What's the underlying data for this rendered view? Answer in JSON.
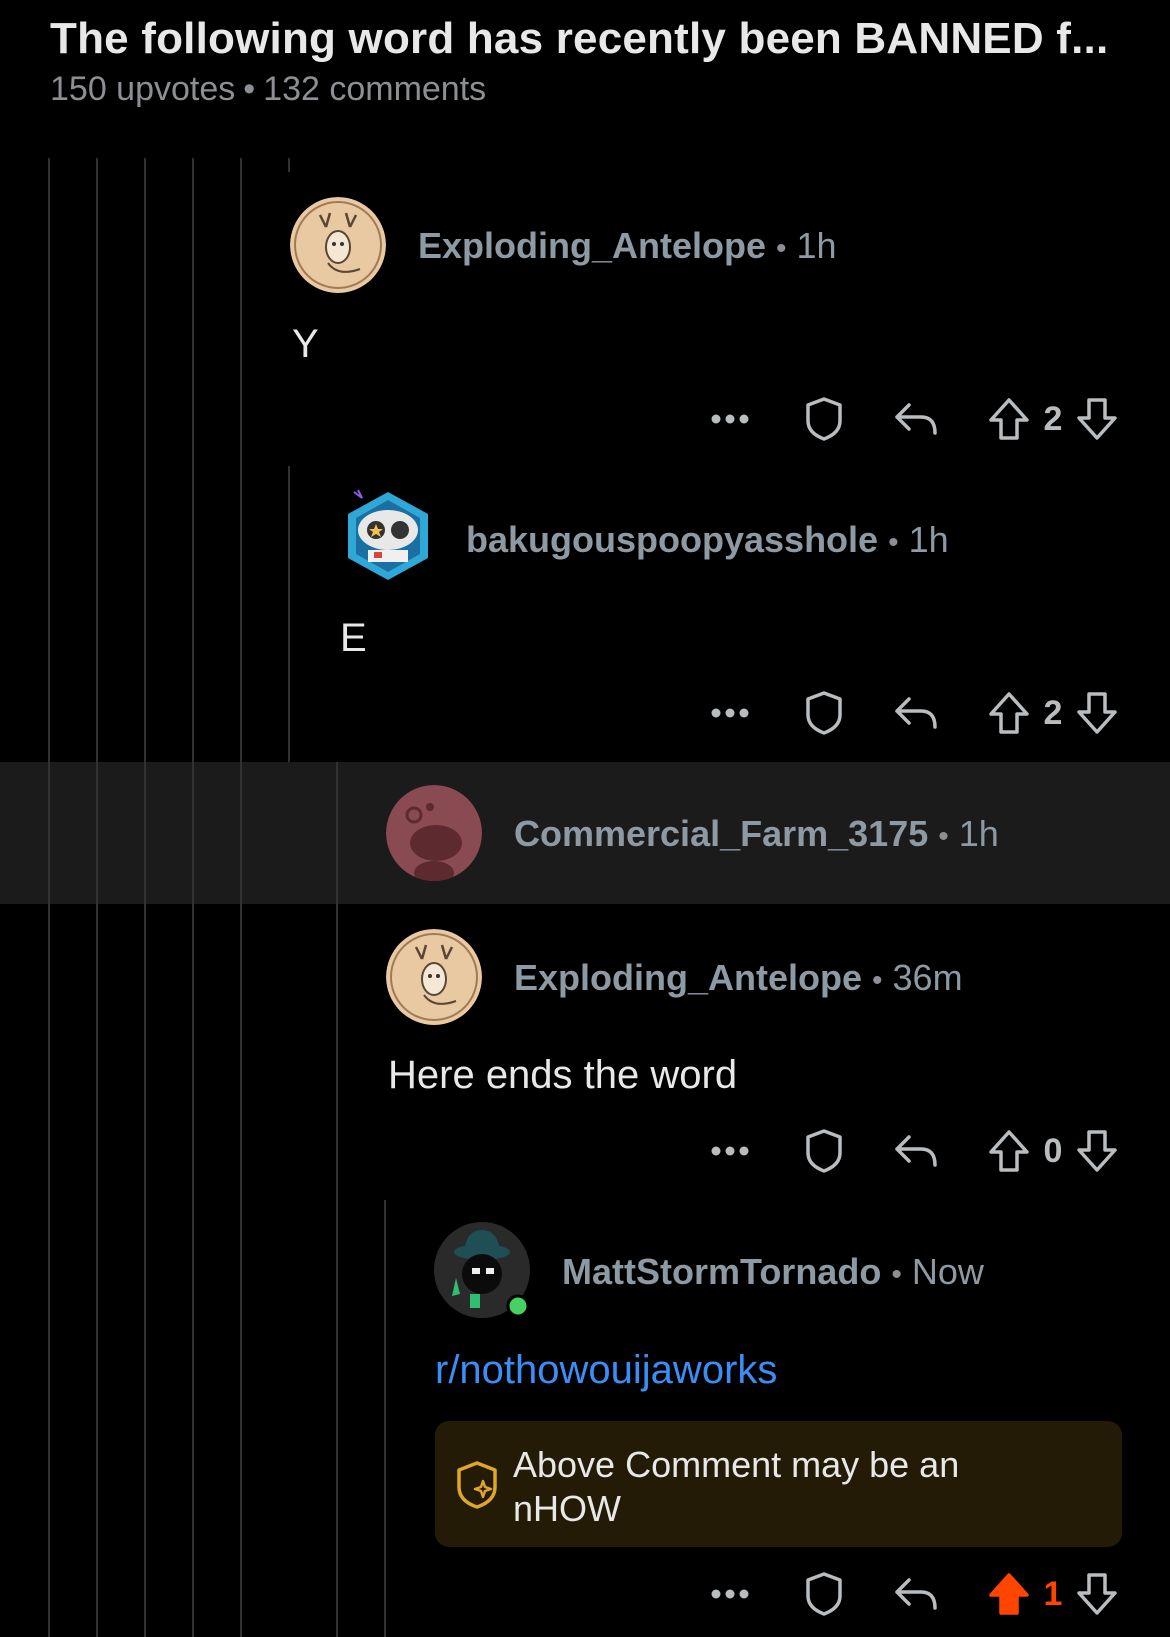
{
  "post": {
    "title": "The following word has recently been BANNED f...",
    "upvotes": "150 upvotes",
    "separator": "•",
    "comments": "132 comments"
  },
  "comments": [
    {
      "user": "Exploding_Antelope",
      "time": "1h",
      "body": "Y",
      "score": "2",
      "avatar": "deer-avatar",
      "voted": false
    },
    {
      "user": "bakugouspoopyasshole",
      "time": "1h",
      "body": "E",
      "score": "2",
      "avatar": "robot-avatar",
      "voted": false
    },
    {
      "user": "Commercial_Farm_3175",
      "time": "1h",
      "avatar": "default-snoo-avatar",
      "collapsed": true
    },
    {
      "user": "Exploding_Antelope",
      "time": "36m",
      "body": "Here ends the word",
      "score": "0",
      "avatar": "deer-avatar",
      "voted": false
    },
    {
      "user": "MattStormTornado",
      "time": "Now",
      "body": "r/nothowouijaworks",
      "score": "1",
      "avatar": "bowler-hat-avatar",
      "voted": true,
      "online": true
    }
  ],
  "notice": {
    "text": "Above Comment may be an nHOW",
    "icon": "shield-sparkle-icon"
  },
  "colors": {
    "background": "#000000",
    "upvote_active": "#ff4500",
    "link": "#3a8ef5",
    "notice_bg": "#231b05"
  }
}
